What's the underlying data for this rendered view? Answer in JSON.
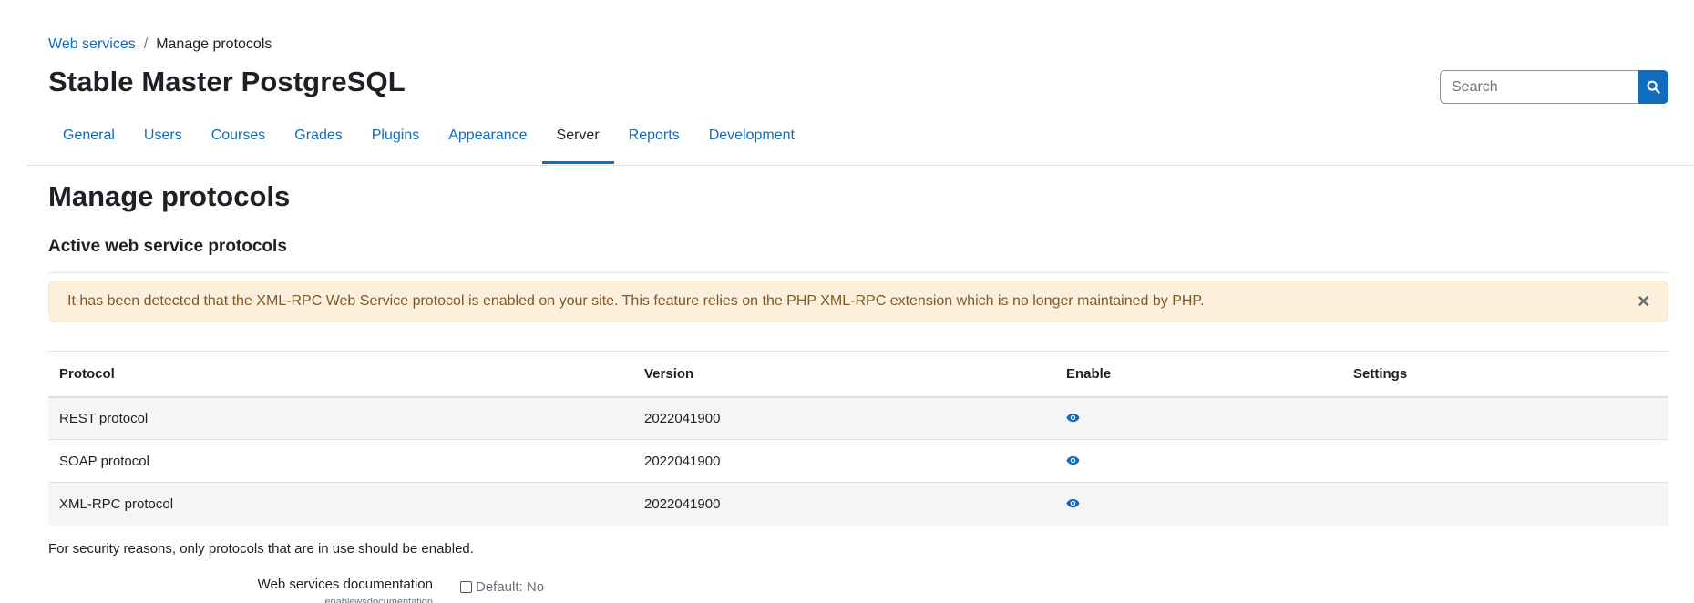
{
  "breadcrumb": {
    "parent": "Web services",
    "current": "Manage protocols"
  },
  "site_title": "Stable Master PostgreSQL",
  "search": {
    "placeholder": "Search"
  },
  "tabs": [
    {
      "label": "General",
      "active": false
    },
    {
      "label": "Users",
      "active": false
    },
    {
      "label": "Courses",
      "active": false
    },
    {
      "label": "Grades",
      "active": false
    },
    {
      "label": "Plugins",
      "active": false
    },
    {
      "label": "Appearance",
      "active": false
    },
    {
      "label": "Server",
      "active": true
    },
    {
      "label": "Reports",
      "active": false
    },
    {
      "label": "Development",
      "active": false
    }
  ],
  "page_heading": "Manage protocols",
  "section_heading": "Active web service protocols",
  "alert": {
    "message": "It has been detected that the XML-RPC Web Service protocol is enabled on your site. This feature relies on the PHP XML-RPC extension which is no longer maintained by PHP.",
    "close": "×"
  },
  "table": {
    "headers": {
      "protocol": "Protocol",
      "version": "Version",
      "enable": "Enable",
      "settings": "Settings"
    },
    "rows": [
      {
        "protocol": "REST protocol",
        "version": "2022041900",
        "enable_icon": "eye-icon",
        "settings": ""
      },
      {
        "protocol": "SOAP protocol",
        "version": "2022041900",
        "enable_icon": "eye-icon",
        "settings": ""
      },
      {
        "protocol": "XML-RPC protocol",
        "version": "2022041900",
        "enable_icon": "eye-icon",
        "settings": ""
      }
    ]
  },
  "note": "For security reasons, only protocols that are in use should be enabled.",
  "setting": {
    "label": "Web services documentation",
    "sublabel": "enablewsdocumentation",
    "default_text": "Default: No",
    "checked": false
  },
  "colors": {
    "link": "#0f6cbf",
    "alert_bg": "#fcefdc",
    "alert_text": "#7d5a29"
  }
}
